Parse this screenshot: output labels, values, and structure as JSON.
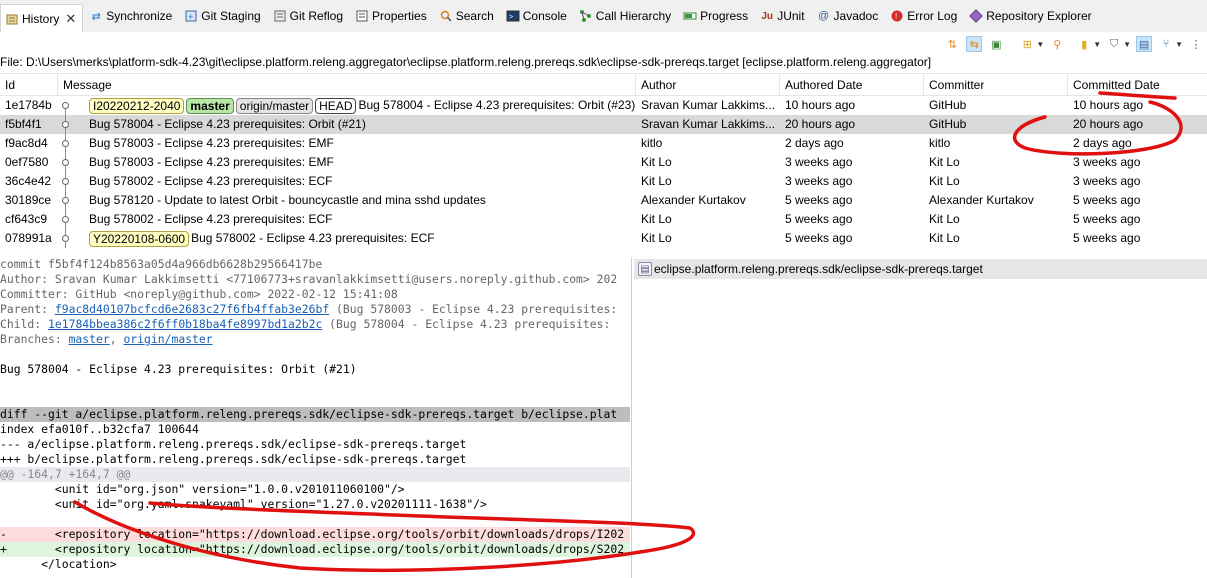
{
  "tabs": [
    {
      "label": "History",
      "icon": "history-icon",
      "active": true
    },
    {
      "label": "Synchronize",
      "icon": "synchronize-icon"
    },
    {
      "label": "Git Staging",
      "icon": "git-staging-icon"
    },
    {
      "label": "Git Reflog",
      "icon": "git-reflog-icon"
    },
    {
      "label": "Properties",
      "icon": "properties-icon"
    },
    {
      "label": "Search",
      "icon": "search-icon"
    },
    {
      "label": "Console",
      "icon": "console-icon"
    },
    {
      "label": "Call Hierarchy",
      "icon": "call-hierarchy-icon"
    },
    {
      "label": "Progress",
      "icon": "progress-icon"
    },
    {
      "label": "JUnit",
      "icon": "junit-icon"
    },
    {
      "label": "Javadoc",
      "icon": "javadoc-icon"
    },
    {
      "label": "Error Log",
      "icon": "error-log-icon"
    },
    {
      "label": "Repository Explorer",
      "icon": "repository-explorer-icon"
    }
  ],
  "file_line": "File: D:\\Users\\merks\\platform-sdk-4.23\\git\\eclipse.platform.releng.aggregator\\eclipse.platform.releng.prereqs.sdk\\eclipse-sdk-prereqs.target [eclipse.platform.releng.aggregator]",
  "columns": {
    "id": "Id",
    "message": "Message",
    "author": "Author",
    "authored_date": "Authored Date",
    "committer": "Committer",
    "committed_date": "Committed Date"
  },
  "commits": [
    {
      "id": "1e1784b",
      "badges": [
        {
          "text": "I20220212-2040",
          "kind": "tag"
        },
        {
          "text": "master",
          "kind": "local"
        },
        {
          "text": "origin/master",
          "kind": "remote"
        },
        {
          "text": "HEAD",
          "kind": "head"
        }
      ],
      "message": "Bug 578004 - Eclipse 4.23 prerequisites: Orbit (#23)",
      "author": "Sravan Kumar Lakkims...",
      "authored_date": "10 hours ago",
      "committer": "GitHub",
      "committed_date": "10 hours ago"
    },
    {
      "id": "f5bf4f1",
      "badges": [],
      "message": "Bug 578004 - Eclipse 4.23 prerequisites: Orbit (#21)",
      "author": "Sravan Kumar Lakkims...",
      "authored_date": "20 hours ago",
      "committer": "GitHub",
      "committed_date": "20 hours ago",
      "selected": true
    },
    {
      "id": "f9ac8d4",
      "badges": [],
      "message": "Bug 578003 - Eclipse 4.23 prerequisites: EMF",
      "author": "kitlo",
      "authored_date": "2 days ago",
      "committer": "kitlo",
      "committed_date": "2 days ago"
    },
    {
      "id": "0ef7580",
      "badges": [],
      "message": "Bug 578003 - Eclipse 4.23 prerequisites: EMF",
      "author": "Kit Lo",
      "authored_date": "3 weeks ago",
      "committer": "Kit Lo",
      "committed_date": "3 weeks ago"
    },
    {
      "id": "36c4e42",
      "badges": [],
      "message": "Bug 578002 - Eclipse 4.23 prerequisites: ECF",
      "author": "Kit Lo",
      "authored_date": "3 weeks ago",
      "committer": "Kit Lo",
      "committed_date": "3 weeks ago"
    },
    {
      "id": "30189ce",
      "badges": [],
      "message": "Bug 578120 - Update to latest Orbit - bouncycastle and mina sshd updates",
      "author": "Alexander Kurtakov",
      "authored_date": "5 weeks ago",
      "committer": "Alexander Kurtakov",
      "committed_date": "5 weeks ago"
    },
    {
      "id": "cf643c9",
      "badges": [],
      "message": "Bug 578002 - Eclipse 4.23 prerequisites: ECF",
      "author": "Kit Lo",
      "authored_date": "5 weeks ago",
      "committer": "Kit Lo",
      "committed_date": "5 weeks ago"
    },
    {
      "id": "078991a",
      "badges": [
        {
          "text": "Y20220108-0600",
          "kind": "tag"
        }
      ],
      "message": "Bug 578002 - Eclipse 4.23 prerequisites: ECF",
      "author": "Kit Lo",
      "authored_date": "5 weeks ago",
      "committer": "Kit Lo",
      "committed_date": "5 weeks ago"
    }
  ],
  "details": {
    "commit": "commit f5bf4f124b8563a05d4a966db6628b29566417be",
    "author": "Author: Sravan Kumar Lakkimsetti <77106773+sravanlakkimsetti@users.noreply.github.com> 202",
    "committer": "Committer: GitHub <noreply@github.com> 2022-02-12 15:41:08",
    "parent_prefix": "Parent: ",
    "parent_hash": "f9ac8d40107bcfcd6e2683c27f6fb4ffab3e26bf",
    "parent_rest": " (Bug 578003 - Eclipse 4.23 prerequisites:",
    "child_prefix": "Child: ",
    "child_hash": "1e1784bbea386c2f6ff0b18ba4fe8997bd1a2b2c",
    "child_rest": " (Bug 578004 - Eclipse 4.23 prerequisites:",
    "branches_prefix": "Branches: ",
    "branch1": "master",
    "branch_sep": ", ",
    "branch2": "origin/master",
    "message": "Bug 578004 - Eclipse 4.23 prerequisites: Orbit (#21)",
    "diff_header": "diff --git a/eclipse.platform.releng.prereqs.sdk/eclipse-sdk-prereqs.target b/eclipse.plat",
    "index": "index efa010f..b32cfa7 100644",
    "minus_file": "--- a/eclipse.platform.releng.prereqs.sdk/eclipse-sdk-prereqs.target",
    "plus_file": "+++ b/eclipse.platform.releng.prereqs.sdk/eclipse-sdk-prereqs.target",
    "hunk": "@@ -164,7 +164,7 @@",
    "ctx1": "        <unit id=\"org.json\" version=\"1.0.0.v201011060100\"/>",
    "ctx2": "        <unit id=\"org.yaml.snakeyaml\" version=\"1.27.0.v20201111-1638\"/>",
    "ctx3": "",
    "del": "-       <repository location=\"https://download.eclipse.org/tools/orbit/downloads/drops/I202",
    "add": "+       <repository location=\"https://download.eclipse.org/tools/orbit/downloads/drops/S202",
    "ctx4": "      </location>"
  },
  "changed_file": "eclipse.platform.releng.prereqs.sdk/eclipse-sdk-prereqs.target",
  "colors": {
    "annotation": "#e01010",
    "selected_row": "#d9d9d9",
    "link": "#1a5fb4"
  }
}
